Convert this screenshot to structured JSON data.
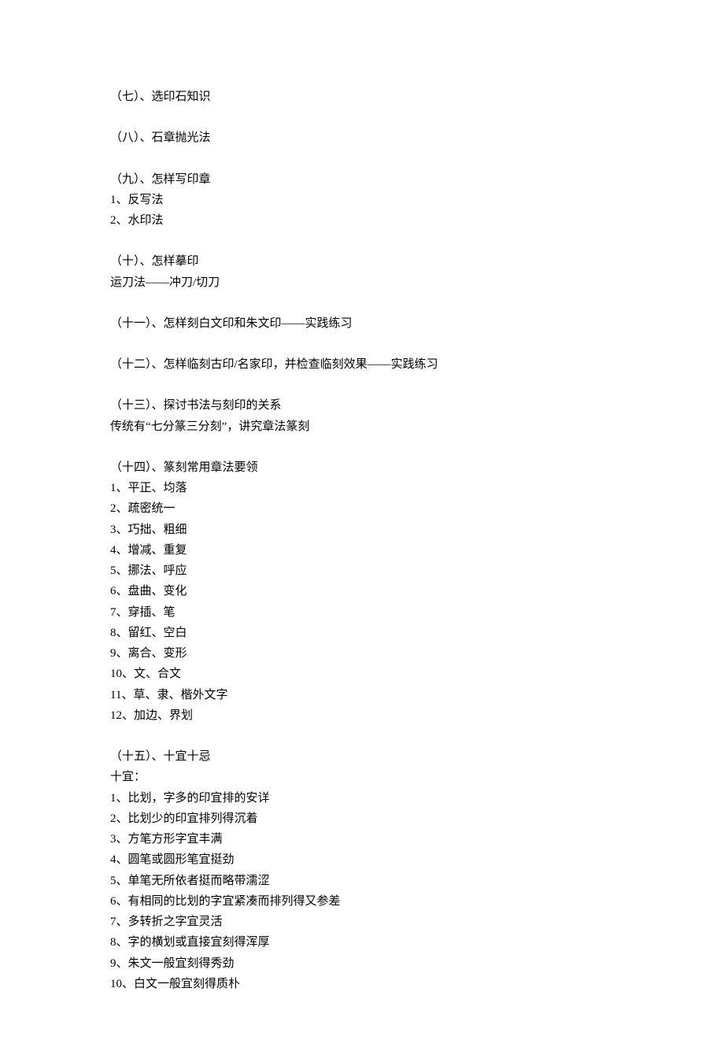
{
  "sections": [
    {
      "lines": [
        "（七）、选印石知识"
      ]
    },
    {
      "lines": [
        "（八）、石章抛光法"
      ]
    },
    {
      "lines": [
        "（九）、怎样写印章",
        "1、反写法",
        "2、水印法"
      ]
    },
    {
      "lines": [
        "（十）、怎样摹印",
        "运刀法——冲刀/切刀"
      ]
    },
    {
      "lines": [
        "（十一）、怎样刻白文印和朱文印——实践练习"
      ]
    },
    {
      "lines": [
        "（十二）、怎样临刻古印/名家印，并检查临刻效果——实践练习"
      ]
    },
    {
      "lines": [
        "（十三）、探讨书法与刻印的关系",
        "传统有“七分篆三分刻”，讲究章法篆刻"
      ]
    },
    {
      "lines": [
        "（十四）、篆刻常用章法要领",
        "1、平正、均落",
        "2、疏密统一",
        "3、巧拙、粗细",
        "4、增减、重复",
        "5、挪法、呼应",
        "6、盘曲、变化",
        "7、穿插、笔",
        "8、留红、空白",
        "9、离合、变形",
        "10、文、合文",
        "11、草、隶、楷外文字",
        "12、加边、界划"
      ]
    },
    {
      "lines": [
        "（十五）、十宜十忌",
        "十宜：",
        "1、比划，字多的印宜排的安详",
        "2、比划少的印宜排列得沉着",
        "3、方笔方形字宜丰满",
        "4、圆笔或圆形笔宜挺劲",
        "5、单笔无所依者挺而略带濡涩",
        "6、有相同的比划的字宜紧凑而排列得又参差",
        "7、多转折之字宜灵活",
        "8、字的横划或直接宜刻得浑厚",
        "9、朱文一般宜刻得秀劲",
        "10、白文一般宜刻得质朴"
      ]
    }
  ]
}
